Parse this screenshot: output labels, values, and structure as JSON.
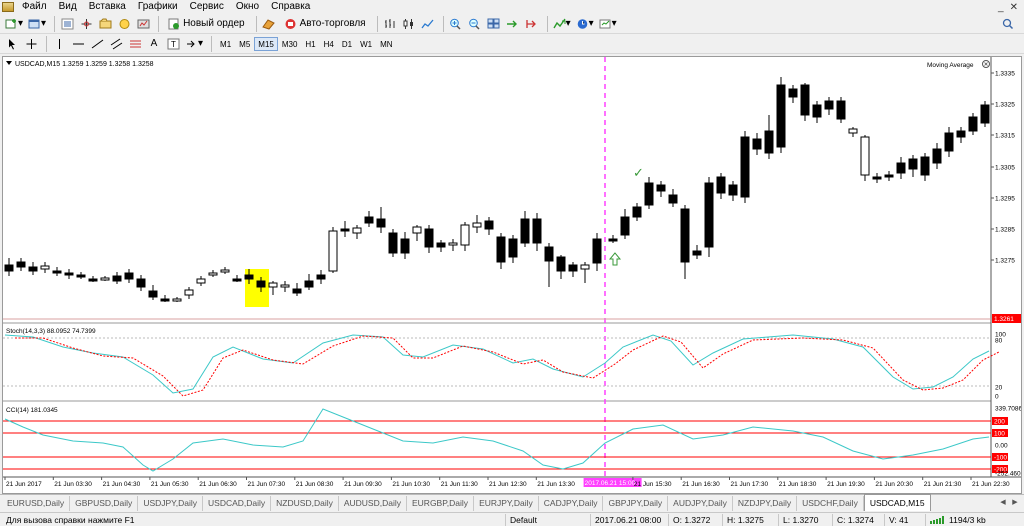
{
  "menu": [
    "Файл",
    "Вид",
    "Вставка",
    "Графики",
    "Сервис",
    "Окно",
    "Справка"
  ],
  "window_controls": [
    "_",
    "✕"
  ],
  "toolbar": {
    "new_order": "Новый ордер",
    "auto_trading": "Авто-торговля"
  },
  "drawing_tools": {
    "text_tool": "A",
    "label_tool": "T"
  },
  "timeframes": [
    "M1",
    "M5",
    "M15",
    "M30",
    "H1",
    "H4",
    "D1",
    "W1",
    "MN"
  ],
  "active_timeframe": "M15",
  "chart": {
    "info": "USDCAD,M15  1.3259 1.3259 1.3258 1.3258",
    "indicator_label": "Moving Average",
    "price_ticks": [
      "1.3335",
      "1.3325",
      "1.3315",
      "1.3305",
      "1.3295",
      "1.3285",
      "1.3275"
    ],
    "current_price": "1.3261",
    "stoch_label": "Stoch(14,3,3) 88.0952 74.7399",
    "stoch_ticks": [
      "100",
      "80",
      "20",
      "0"
    ],
    "cci_label": "CCI(14) 181.0345",
    "cci_ticks": [
      "339.7086",
      "200",
      "100",
      "0.00",
      "-100",
      "-200",
      "-252.460"
    ],
    "time_ticks": [
      "21 Jun 2017",
      "21 Jun 03:30",
      "21 Jun 04:30",
      "21 Jun 05:30",
      "21 Jun 06:30",
      "21 Jun 07:30",
      "21 Jun 08:30",
      "21 Jun 09:30",
      "21 Jun 10:30",
      "21 Jun 11:30",
      "21 Jun 12:30",
      "21 Jun 13:30",
      "2017.06.21 15:00",
      "21 Jun 15:30",
      "21 Jun 16:30",
      "21 Jun 17:30",
      "21 Jun 18:30",
      "21 Jun 19:30",
      "21 Jun 20:30",
      "21 Jun 21:30",
      "21 Jun 22:30"
    ],
    "colors": {
      "marker_line": "#ff40ff",
      "highlight": "#ffff00",
      "stoch_main": "#3cc8c8",
      "stoch_signal": "#ff0000",
      "cci": "#3cc8c8",
      "levels": "#ff0000",
      "buy_arrow": "#3a9a3a"
    }
  },
  "tabs": [
    "EURUSD,Daily",
    "GBPUSD,Daily",
    "USDJPY,Daily",
    "USDCAD,Daily",
    "NZDUSD,Daily",
    "AUDUSD,Daily",
    "EURGBP,Daily",
    "EURJPY,Daily",
    "CADJPY,Daily",
    "GBPJPY,Daily",
    "AUDJPY,Daily",
    "NZDJPY,Daily",
    "USDCHF,Daily",
    "USDCAD,M15"
  ],
  "active_tab": "USDCAD,M15",
  "status": {
    "help": "Для вызова справки нажмите F1",
    "profile": "Default",
    "datetime": "2017.06.21 08:00",
    "open": "O: 1.3272",
    "high": "H: 1.3275",
    "low": "L: 1.3270",
    "close": "C: 1.3274",
    "volume": "V: 41",
    "traffic": "1194/3 kb"
  }
}
